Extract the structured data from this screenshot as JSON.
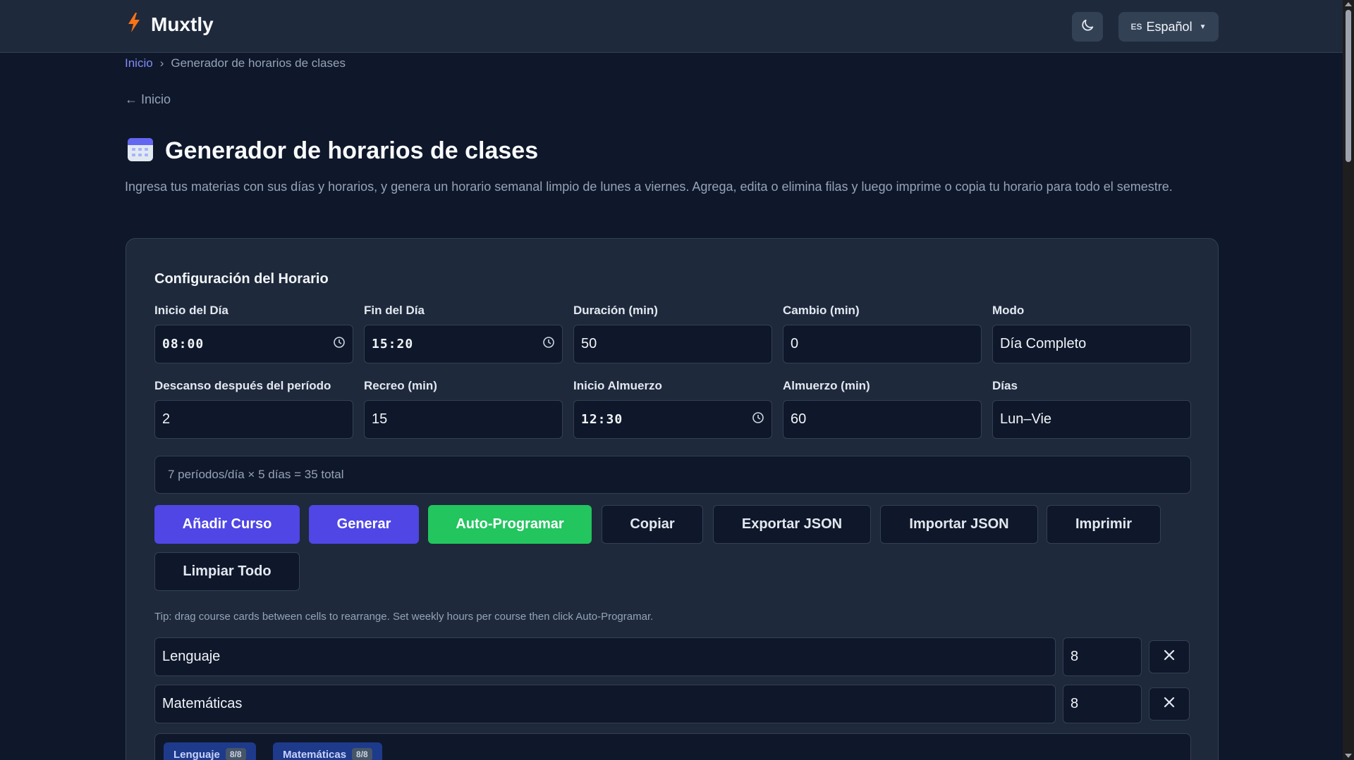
{
  "app": {
    "name": "Muxtly",
    "accent": "#4f46e5",
    "success": "#22c55e"
  },
  "header": {
    "theme_icon": "moon-icon",
    "language": {
      "code": "ES",
      "label": "Español"
    }
  },
  "breadcrumb": {
    "home": "Inicio",
    "separator": "›",
    "current": "Generador de horarios de clases"
  },
  "back_link": "← Inicio",
  "page": {
    "title": "Generador de horarios de clases",
    "icon": "calendar-icon",
    "description": "Ingresa tus materias con sus días y horarios, y genera un horario semanal limpio de lunes a viernes. Agrega, edita o elimina filas y luego imprime o copia tu horario para todo el semestre."
  },
  "config": {
    "title": "Configuración del Horario",
    "fields": {
      "day_start": {
        "label": "Inicio del Día",
        "value": "08:00"
      },
      "day_end": {
        "label": "Fin del Día",
        "value": "15:20"
      },
      "duration": {
        "label": "Duración (min)",
        "value": "50"
      },
      "change": {
        "label": "Cambio (min)",
        "value": "0"
      },
      "mode": {
        "label": "Modo",
        "value": "Día Completo"
      },
      "break_after": {
        "label": "Descanso después del período",
        "value": "2"
      },
      "recess": {
        "label": "Recreo (min)",
        "value": "15"
      },
      "lunch_start": {
        "label": "Inicio Almuerzo",
        "value": "12:30"
      },
      "lunch": {
        "label": "Almuerzo (min)",
        "value": "60"
      },
      "days": {
        "label": "Días",
        "value": "Lun–Vie"
      }
    },
    "summary": "7 períodos/día × 5 días = 35 total"
  },
  "buttons": {
    "add_course": "Añadir Curso",
    "generate": "Generar",
    "auto_schedule": "Auto-Programar",
    "copy": "Copiar",
    "export_json": "Exportar JSON",
    "import_json": "Importar JSON",
    "print": "Imprimir",
    "clear_all": "Limpiar Todo"
  },
  "tip": "Tip: drag course cards between cells to rearrange. Set weekly hours per course then click Auto-Programar.",
  "courses": [
    {
      "name": "Lenguaje",
      "hours": "8"
    },
    {
      "name": "Matemáticas",
      "hours": "8"
    }
  ],
  "pool": [
    {
      "name": "Lenguaje",
      "count": "8/8"
    },
    {
      "name": "Matemáticas",
      "count": "8/8"
    }
  ]
}
